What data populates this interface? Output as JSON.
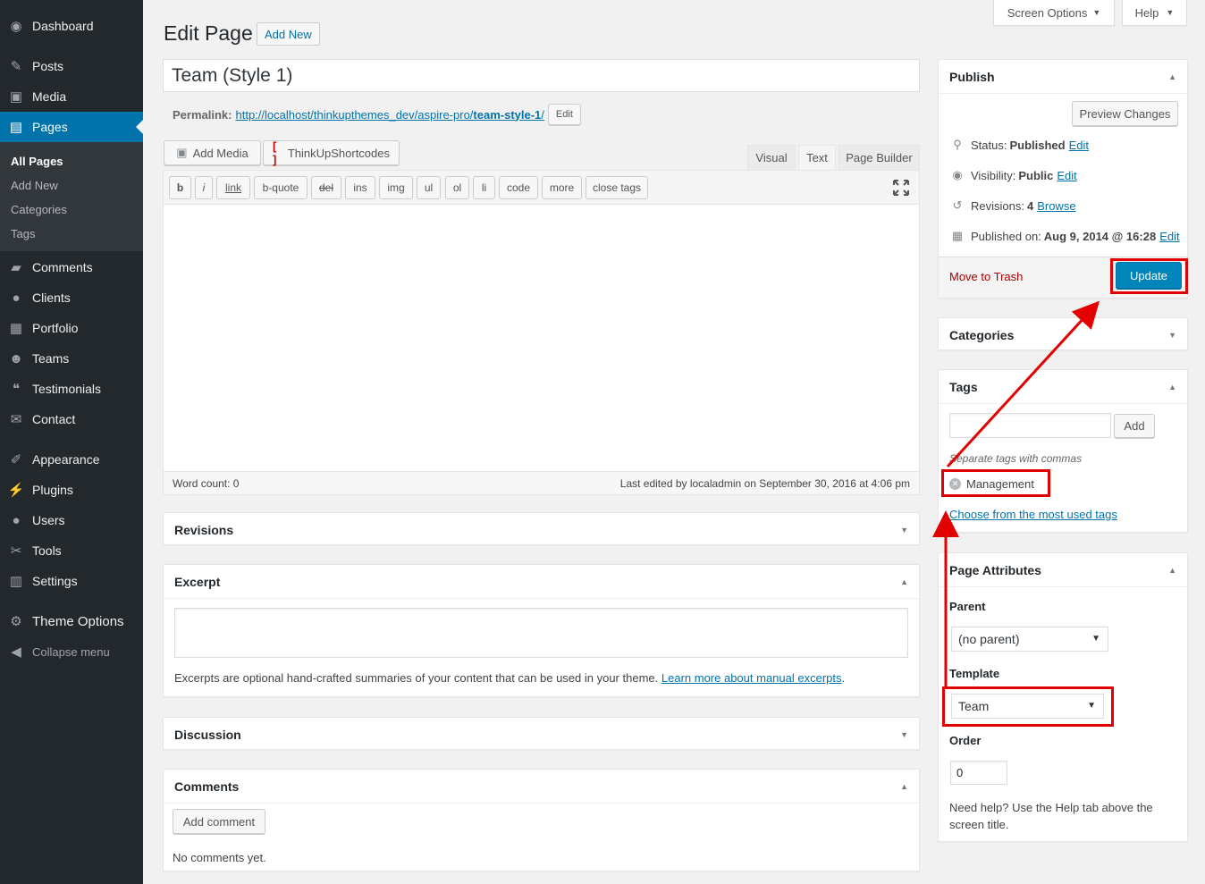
{
  "sidebar": {
    "items": [
      {
        "label": "Dashboard",
        "icon": "dashboard-icon"
      },
      {
        "label": "Posts",
        "icon": "pin-icon"
      },
      {
        "label": "Media",
        "icon": "media-icon"
      },
      {
        "label": "Pages",
        "icon": "pages-icon"
      },
      {
        "label": "Comments",
        "icon": "comments-icon"
      },
      {
        "label": "Clients",
        "icon": "user-icon"
      },
      {
        "label": "Portfolio",
        "icon": "portfolio-icon"
      },
      {
        "label": "Teams",
        "icon": "groups-icon"
      },
      {
        "label": "Testimonials",
        "icon": "testimonials-icon"
      },
      {
        "label": "Contact",
        "icon": "email-icon"
      },
      {
        "label": "Appearance",
        "icon": "paintbrush-icon"
      },
      {
        "label": "Plugins",
        "icon": "plugin-icon"
      },
      {
        "label": "Users",
        "icon": "users-icon"
      },
      {
        "label": "Tools",
        "icon": "wrench-icon"
      },
      {
        "label": "Settings",
        "icon": "settings-icon"
      },
      {
        "label": "Theme Options",
        "icon": "gear-icon"
      },
      {
        "label": "Collapse menu",
        "icon": "collapse-icon"
      }
    ],
    "submenu": [
      "All Pages",
      "Add New",
      "Categories",
      "Tags"
    ]
  },
  "top": {
    "screen_options": "Screen Options",
    "help": "Help"
  },
  "header": {
    "title": "Edit Page",
    "add_new": "Add New"
  },
  "post": {
    "title": "Team (Style 1)",
    "permalink_label": "Permalink:",
    "permalink_base": "http://localhost/thinkupthemes_dev/aspire-pro/",
    "permalink_slug": "team-style-1",
    "permalink_end": "/",
    "permalink_edit": "Edit"
  },
  "editor": {
    "add_media": "Add Media",
    "shortcodes": "ThinkUpShortcodes",
    "tabs": [
      "Visual",
      "Text",
      "Page Builder"
    ],
    "quicktags": [
      "b",
      "i",
      "link",
      "b-quote",
      "del",
      "ins",
      "img",
      "ul",
      "ol",
      "li",
      "code",
      "more",
      "close tags"
    ],
    "word_count": "Word count: 0",
    "last_edited": "Last edited by localadmin on September 30, 2016 at 4:06 pm"
  },
  "boxes": {
    "revisions": "Revisions",
    "excerpt": "Excerpt",
    "excerpt_help": "Excerpts are optional hand-crafted summaries of your content that can be used in your theme.",
    "excerpt_link": "Learn more about manual excerpts",
    "discussion": "Discussion",
    "comments": "Comments",
    "add_comment": "Add comment",
    "no_comments": "No comments yet."
  },
  "publish": {
    "title": "Publish",
    "preview": "Preview Changes",
    "status_label": "Status:",
    "status_value": "Published",
    "visibility_label": "Visibility:",
    "visibility_value": "Public",
    "revisions_label": "Revisions:",
    "revisions_value": "4",
    "browse": "Browse",
    "published_label": "Published on:",
    "published_value": "Aug 9, 2014 @ 16:28",
    "edit": "Edit",
    "trash": "Move to Trash",
    "update": "Update"
  },
  "categories": {
    "title": "Categories"
  },
  "tags": {
    "title": "Tags",
    "add": "Add",
    "hint": "Separate tags with commas",
    "tag": "Management",
    "choose": "Choose from the most used tags"
  },
  "attributes": {
    "title": "Page Attributes",
    "parent_label": "Parent",
    "parent_value": "(no parent)",
    "template_label": "Template",
    "template_value": "Team",
    "order_label": "Order",
    "order_value": "0",
    "help": "Need help? Use the Help tab above the screen title."
  },
  "colors": {
    "sidebar": "#23282d",
    "accent": "#0073aa",
    "highlight": "#e30000",
    "trash": "#a00"
  }
}
